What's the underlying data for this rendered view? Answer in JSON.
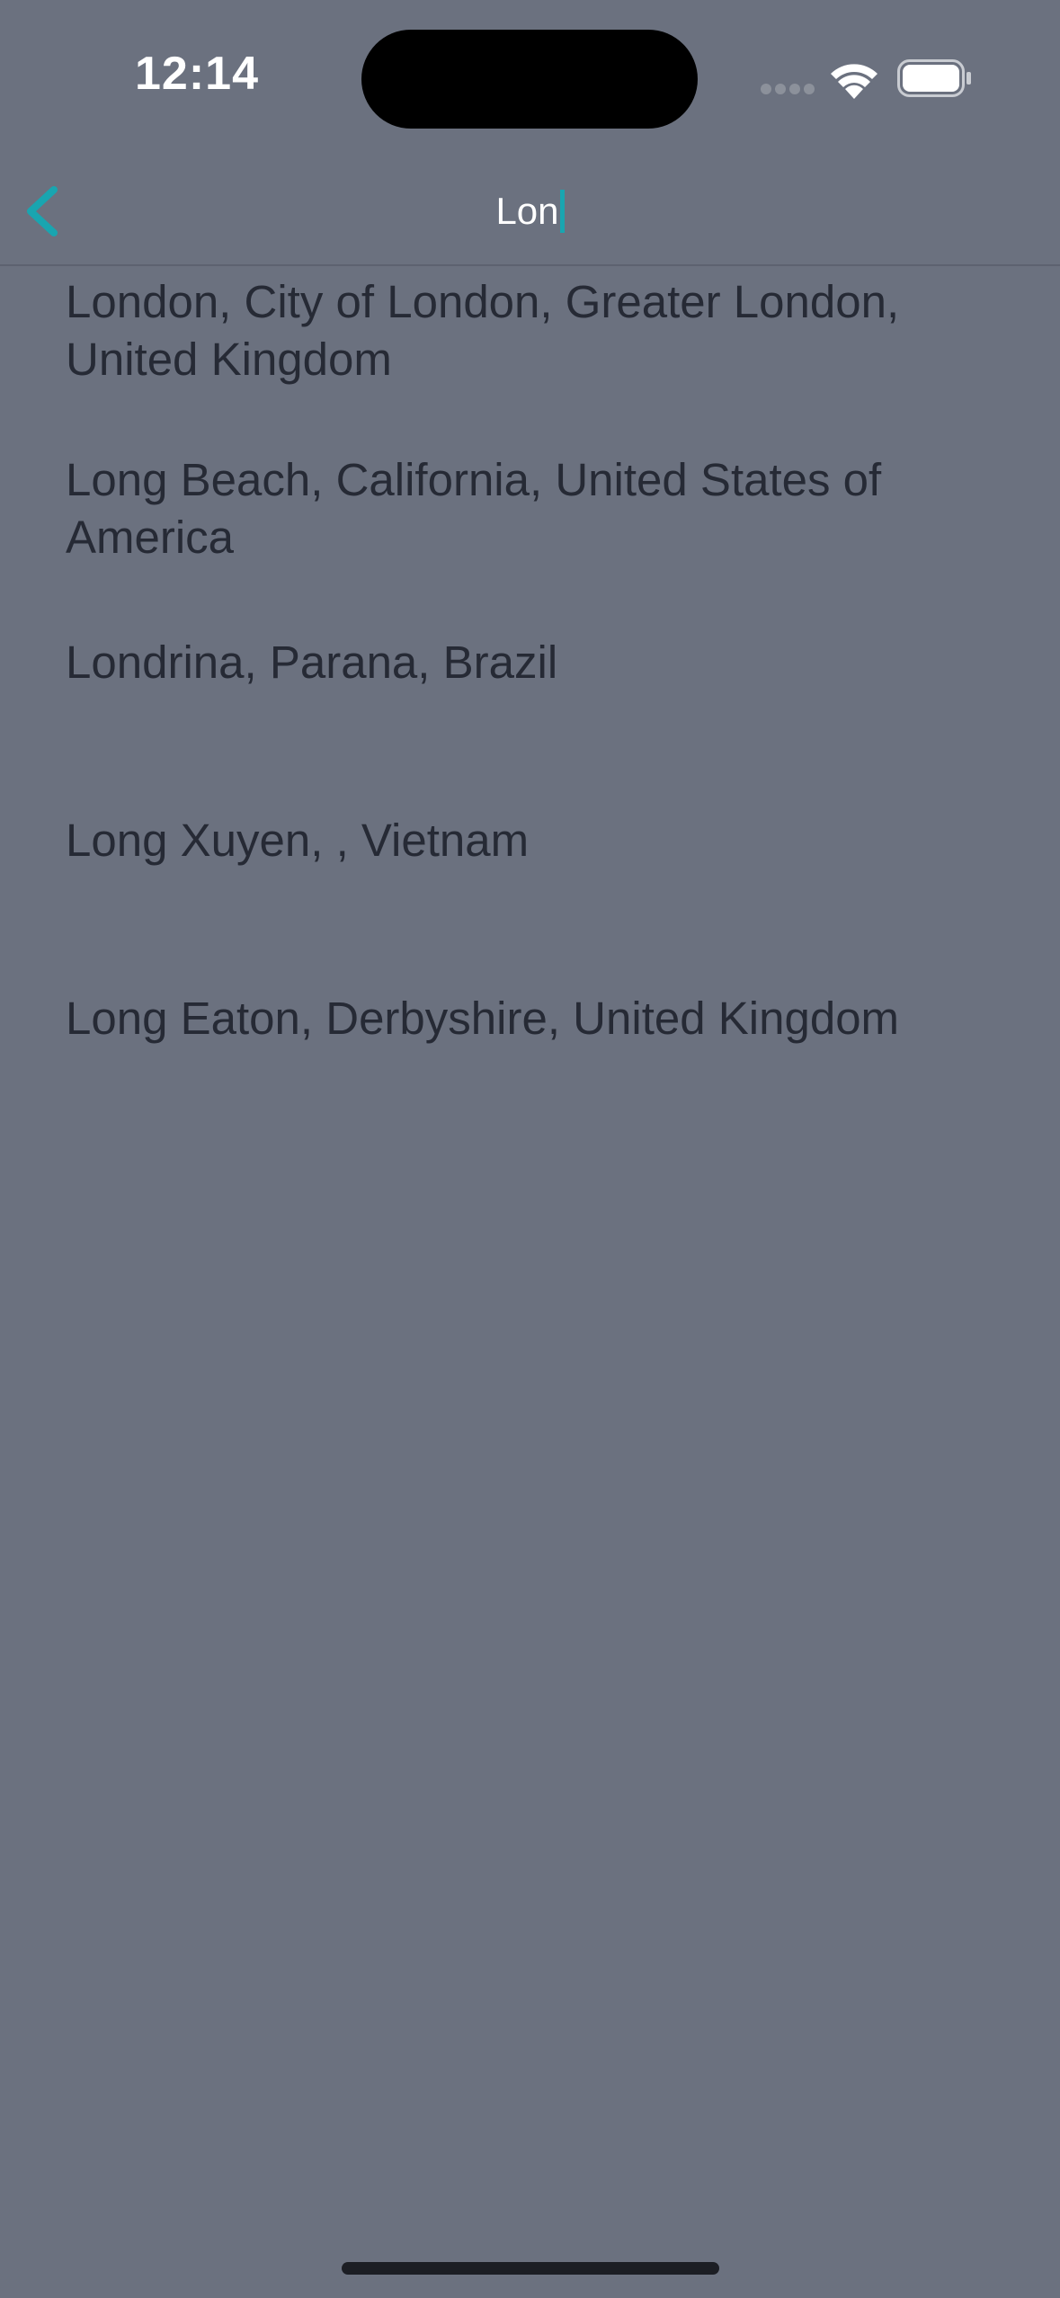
{
  "status_bar": {
    "time": "12:14"
  },
  "nav": {
    "back_icon": "chevron-left-icon",
    "search_value": "Lon",
    "accent_color": "#19a5b0"
  },
  "results": [
    {
      "label": "London, City of London, Greater London, United Kingdom"
    },
    {
      "label": "Long Beach, California, United States of America"
    },
    {
      "label": "Londrina, Parana, Brazil"
    },
    {
      "label": "Long Xuyen, , Vietnam"
    },
    {
      "label": "Long Eaton, Derbyshire, United Kingdom"
    }
  ]
}
